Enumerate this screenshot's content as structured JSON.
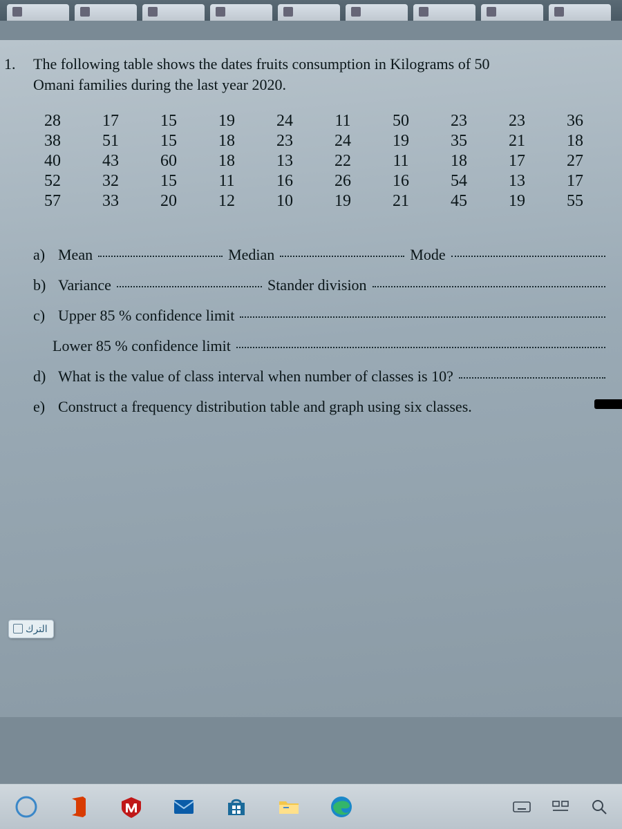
{
  "question_number": "1.",
  "question_text_line1": "The following table shows the dates fruits consumption in Kilograms of 50",
  "question_text_line2": "Omani families during the last year 2020.",
  "table": [
    [
      "28",
      "17",
      "15",
      "19",
      "24",
      "11",
      "50",
      "23",
      "23",
      "36"
    ],
    [
      "38",
      "51",
      "15",
      "18",
      "23",
      "24",
      "19",
      "35",
      "21",
      "18"
    ],
    [
      "40",
      "43",
      "60",
      "18",
      "13",
      "22",
      "11",
      "18",
      "17",
      "27"
    ],
    [
      "52",
      "32",
      "15",
      "11",
      "16",
      "26",
      "16",
      "54",
      "13",
      "17"
    ],
    [
      "57",
      "33",
      "20",
      "12",
      "10",
      "19",
      "21",
      "45",
      "19",
      "55"
    ]
  ],
  "parts": {
    "a_label": "a)",
    "a_mean": "Mean",
    "a_median": "Median",
    "a_mode": "Mode",
    "b_label": "b)",
    "b_var": "Variance",
    "b_std": "Stander division",
    "c_label": "c)",
    "c_upper": "Upper 85 % confidence limit",
    "c_lower": "Lower 85 % confidence limit",
    "d_label": "d)",
    "d_text": "What is the value of class interval when number of classes is 10?",
    "e_label": "e)",
    "e_text": "Construct a frequency distribution table and graph using six classes."
  },
  "leave_button": "الترك",
  "colors": {
    "paper": "#a8b6c0",
    "ink": "#0a1518"
  }
}
